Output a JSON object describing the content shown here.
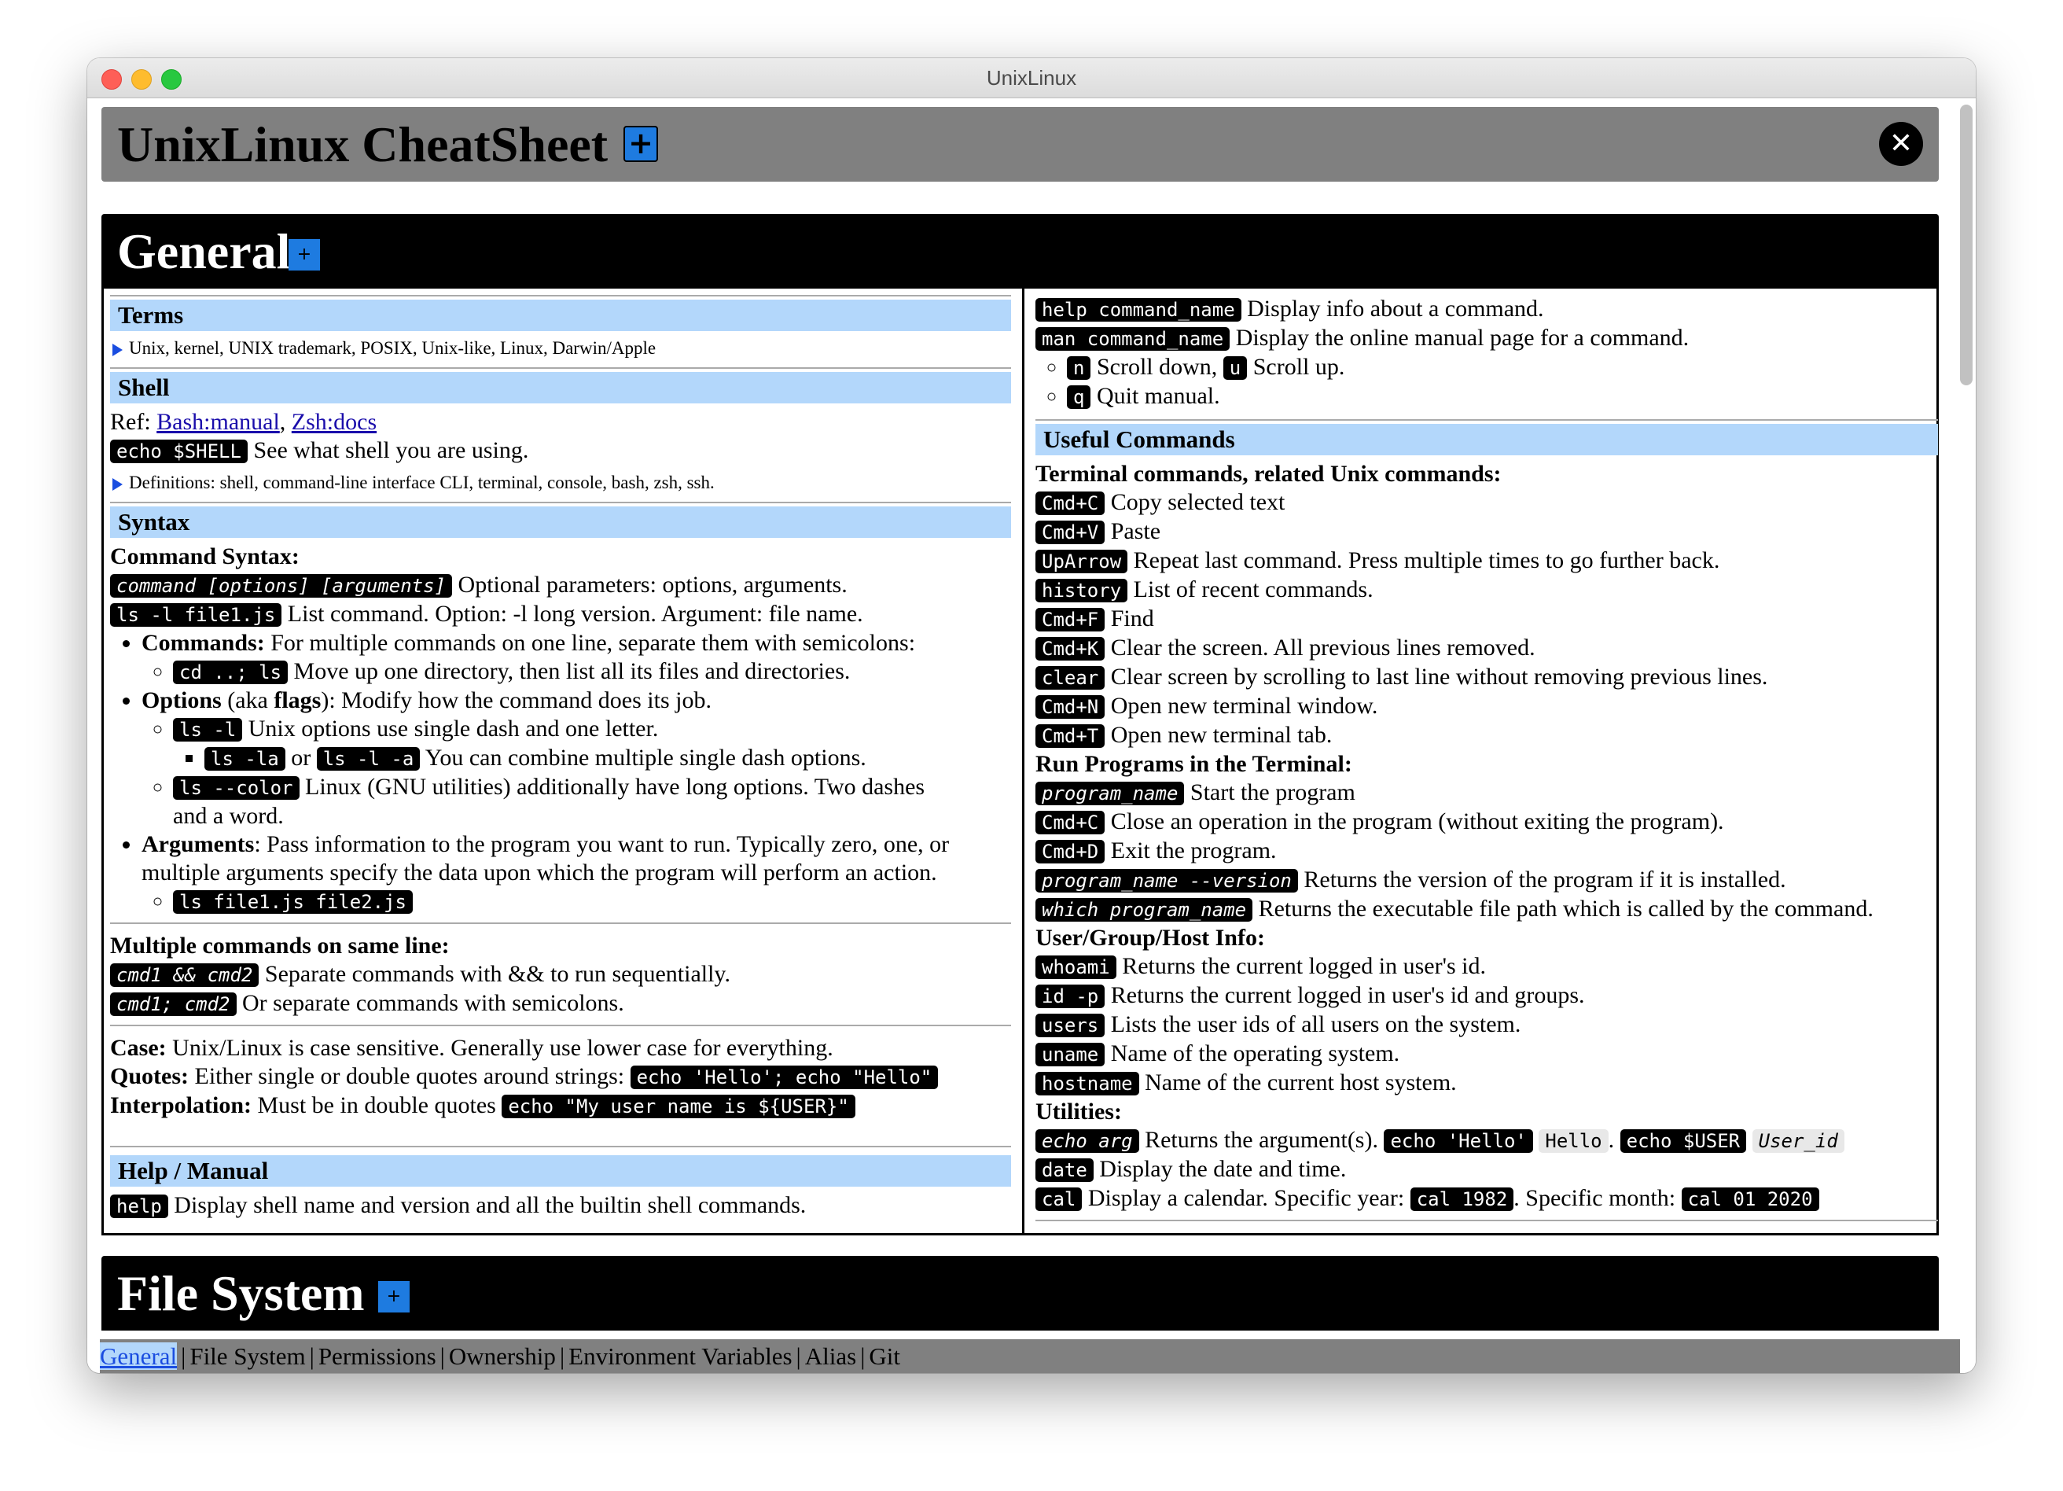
{
  "window": {
    "title": "UnixLinux"
  },
  "header": {
    "title": "UnixLinux CheatSheet",
    "plus_icon": "plus-square",
    "close_icon": "close-circle"
  },
  "general": {
    "title": "General",
    "terms": {
      "title": "Terms",
      "summary": "Unix, kernel, UNIX trademark, POSIX, Unix-like, Linux, Darwin/Apple"
    },
    "shell": {
      "title": "Shell",
      "ref_label": "Ref:",
      "link1": "Bash:manual",
      "link2": "Zsh:docs",
      "echo_shell": "echo $SHELL",
      "echo_shell_desc": "See what shell you are using.",
      "definitions": "Definitions: shell, command-line interface CLI, terminal, console, bash, zsh, ssh."
    },
    "syntax": {
      "title": "Syntax",
      "cmd_syntax_label": "Command Syntax:",
      "syntax_code": "command [options] [arguments]",
      "syntax_desc": "Optional parameters: options, arguments.",
      "ls_code": "ls -l file1.js",
      "ls_desc": "List command. Option: -l long version. Argument: file name.",
      "commands_label": "Commands:",
      "commands_desc": "For multiple commands on one line, separate them with semicolons:",
      "cd_code": "cd ..; ls",
      "cd_desc": "Move up one directory, then list all its files and directories.",
      "options_label": "Options",
      "options_aka": "(aka",
      "options_flags": "flags",
      "options_desc": "): Modify how the command does its job.",
      "ls_l_code": "ls -l",
      "ls_l_desc": "Unix options use single dash and one letter.",
      "ls_la_code": "ls -la",
      "or_text": "or",
      "ls_l_a_code": "ls -l -a",
      "combine_desc": "You can combine multiple single dash options.",
      "ls_color_code": "ls --color",
      "ls_color_desc": "Linux (GNU utilities) additionally have long options. Two dashes",
      "ls_color_desc2": "and a word.",
      "arguments_label": "Arguments",
      "arguments_desc": ": Pass information to the program you want to run. Typically zero, one, or",
      "arguments_desc2": "multiple arguments specify the data upon which the program will perform an action.",
      "args_code": "ls file1.js file2.js"
    },
    "multiple": {
      "label": "Multiple commands on same line:",
      "and_code": "cmd1 && cmd2",
      "and_desc": "Separate commands with && to run sequentially.",
      "semi_code": "cmd1; cmd2",
      "semi_desc": "Or separate commands with semicolons."
    },
    "case": {
      "case_label": "Case:",
      "case_desc": "Unix/Linux is case sensitive. Generally use lower case for everything.",
      "quotes_label": "Quotes:",
      "quotes_desc": "Either single or double quotes around strings:",
      "quotes_code": "echo 'Hello'; echo \"Hello\"",
      "interp_label": "Interpolation:",
      "interp_desc": "Must be in double quotes",
      "interp_code": "echo \"My user name is ${USER}\""
    },
    "help": {
      "title": "Help / Manual",
      "help_code": "help",
      "help_desc": "Display shell name and version and all the builtin shell commands.",
      "help_cmd_code": "help command_name",
      "help_cmd_desc": "Display info about a command.",
      "man_code": "man command_name",
      "man_desc": "Display the online manual page for a command.",
      "n_code": "n",
      "n_desc": "Scroll down,",
      "u_code": "u",
      "u_desc": "Scroll up.",
      "q_code": "q",
      "q_desc": "Quit manual."
    },
    "useful": {
      "title": "Useful Commands",
      "terminal_label": "Terminal commands, related Unix commands:",
      "terminal": [
        {
          "code": "Cmd+C",
          "desc": "Copy selected text"
        },
        {
          "code": "Cmd+V",
          "desc": "Paste"
        },
        {
          "code": "UpArrow",
          "desc": "Repeat last command. Press multiple times to go further back."
        },
        {
          "code": "history",
          "desc": "List of recent commands."
        },
        {
          "code": "Cmd+F",
          "desc": "Find"
        },
        {
          "code": "Cmd+K",
          "desc": "Clear the screen. All previous lines removed."
        },
        {
          "code": "clear",
          "desc": "Clear screen by scrolling to last line without removing previous lines."
        },
        {
          "code": "Cmd+N",
          "desc": "Open new terminal window."
        },
        {
          "code": "Cmd+T",
          "desc": "Open new terminal tab."
        }
      ],
      "run_label": "Run Programs in the Terminal:",
      "run": [
        {
          "code": "program_name",
          "desc": "Start the program",
          "italic": true
        },
        {
          "code": "Cmd+C",
          "desc": "Close an operation in the program (without exiting the program).",
          "italic": false
        },
        {
          "code": "Cmd+D",
          "desc": "Exit the program.",
          "italic": false
        },
        {
          "code": "program_name --version",
          "desc": "Returns the version of the program if it is installed.",
          "italic": true
        },
        {
          "code": "which program_name",
          "desc": "Returns the executable file path which is called by the command.",
          "italic": true
        }
      ],
      "user_label": "User/Group/Host Info:",
      "user": [
        {
          "code": "whoami",
          "desc": "Returns the current logged in user's id."
        },
        {
          "code": "id -p",
          "desc": "Returns the current logged in user's id and groups."
        },
        {
          "code": "users",
          "desc": "Lists the user ids of all users on the system."
        },
        {
          "code": "uname",
          "desc": "Name of the operating system."
        },
        {
          "code": "hostname",
          "desc": "Name of the current host system."
        }
      ],
      "util_label": "Utilities:",
      "echo_arg_code": "echo arg",
      "echo_arg_desc": "Returns the argument(s).",
      "echo_hello_code": "echo 'Hello'",
      "hello_out": "Hello",
      "echo_user_code": "echo $USER",
      "user_out": "User_id",
      "date_code": "date",
      "date_desc": "Display the date and time.",
      "cal_code": "cal",
      "cal_desc": "Display a calendar. Specific year:",
      "cal_year_code": "cal 1982",
      "cal_month_label": ". Specific month:",
      "cal_month_code": "cal 01 2020"
    }
  },
  "file_system": {
    "title": "File System"
  },
  "nav": {
    "items": [
      "General",
      "File System",
      "Permissions",
      "Ownership",
      "Environment Variables",
      "Alias",
      "Git"
    ],
    "active": "General",
    "separator": "|"
  }
}
